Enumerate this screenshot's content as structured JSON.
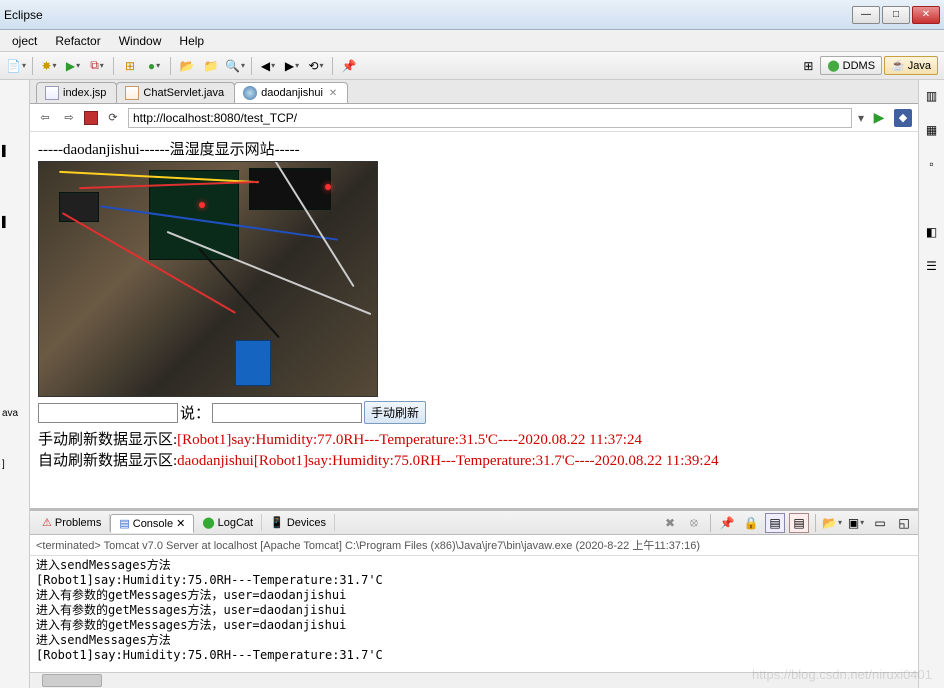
{
  "window": {
    "title_suffix": "Eclipse"
  },
  "menus": {
    "project": "oject",
    "refactor": "Refactor",
    "window": "Window",
    "help": "Help"
  },
  "perspectives": {
    "ddms": "DDMS",
    "java": "Java"
  },
  "editor_tabs": {
    "index": "index.jsp",
    "chatservlet": "ChatServlet.java",
    "daodanjishui": "daodanjishui"
  },
  "browser": {
    "url": "http://localhost:8080/test_TCP/"
  },
  "page": {
    "heading": "-----daodanjishui------温湿度显示网站-----",
    "say_label": "说：",
    "refresh_btn": "手动刷新",
    "manual_prefix": "手动刷新数据显示区:",
    "manual_value": "[Robot1]say:Humidity:77.0RH---Temperature:31.5'C----2020.08.22 11:37:24",
    "auto_prefix": "自动刷新数据显示区:",
    "auto_value": "daodanjishui[Robot1]say:Humidity:75.0RH---Temperature:31.7'C----2020.08.22 11:39:24"
  },
  "bottom_tabs": {
    "problems": "Problems",
    "console": "Console",
    "logcat": "LogCat",
    "devices": "Devices"
  },
  "console_status": "<terminated> Tomcat v7.0 Server at localhost [Apache Tomcat] C:\\Program Files (x86)\\Java\\jre7\\bin\\javaw.exe (2020-8-22 上午11:37:16)",
  "console_lines": [
    "进入sendMessages方法",
    "[Robot1]say:Humidity:75.0RH---Temperature:31.7'C",
    "进入有参数的getMessages方法，user=daodanjishui",
    "进入有参数的getMessages方法，user=daodanjishui",
    "进入有参数的getMessages方法，user=daodanjishui",
    "进入sendMessages方法",
    "[Robot1]say:Humidity:75.0RH---Temperature:31.7'C"
  ],
  "left_items": {
    "java": "ava",
    "bracket": "]"
  },
  "watermark": "https://blog.csdn.net/niruxi0401"
}
